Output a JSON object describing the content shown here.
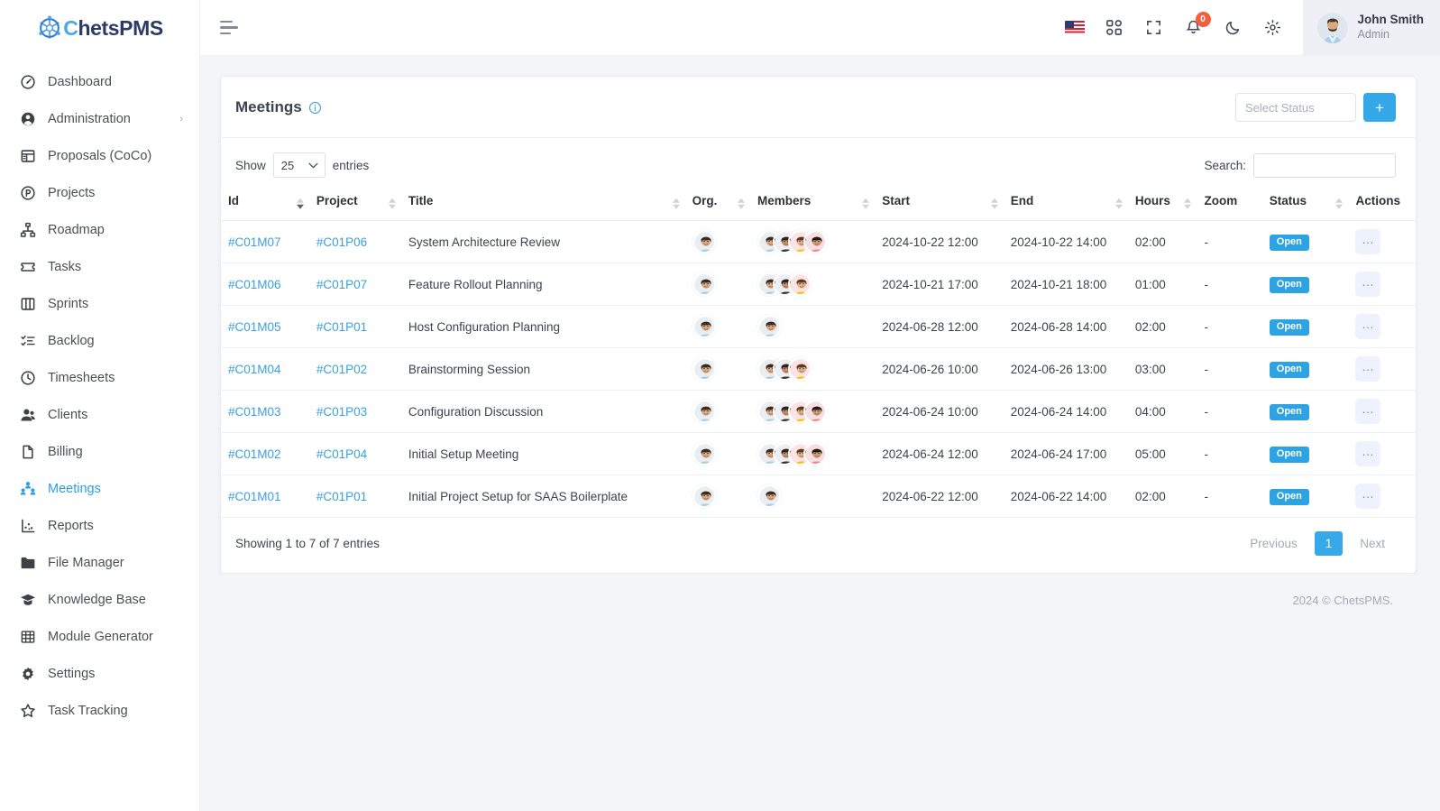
{
  "brand": {
    "name_left": "C",
    "name_full": "ChetsPMS",
    "logo_icon": "chets-logo-icon"
  },
  "sidebar": {
    "items": [
      {
        "label": "Dashboard",
        "icon": "speedometer-icon",
        "active": false,
        "caret": ""
      },
      {
        "label": "Administration",
        "icon": "user-circle-icon",
        "active": false,
        "caret": "›"
      },
      {
        "label": "Proposals (CoCo)",
        "icon": "document-layout-icon",
        "active": false,
        "caret": ""
      },
      {
        "label": "Projects",
        "icon": "circle-p-icon",
        "active": false,
        "caret": ""
      },
      {
        "label": "Roadmap",
        "icon": "hierarchy-icon",
        "active": false,
        "caret": ""
      },
      {
        "label": "Tasks",
        "icon": "ticket-icon",
        "active": false,
        "caret": ""
      },
      {
        "label": "Sprints",
        "icon": "columns-icon",
        "active": false,
        "caret": ""
      },
      {
        "label": "Backlog",
        "icon": "checklist-icon",
        "active": false,
        "caret": ""
      },
      {
        "label": "Timesheets",
        "icon": "clock-icon",
        "active": false,
        "caret": ""
      },
      {
        "label": "Clients",
        "icon": "users-icon",
        "active": false,
        "caret": ""
      },
      {
        "label": "Billing",
        "icon": "file-icon",
        "active": false,
        "caret": ""
      },
      {
        "label": "Meetings",
        "icon": "people-group-icon",
        "active": true,
        "caret": ""
      },
      {
        "label": "Reports",
        "icon": "chart-scatter-icon",
        "active": false,
        "caret": ""
      },
      {
        "label": "File Manager",
        "icon": "folder-icon",
        "active": false,
        "caret": ""
      },
      {
        "label": "Knowledge Base",
        "icon": "graduation-cap-icon",
        "active": false,
        "caret": ""
      },
      {
        "label": "Module Generator",
        "icon": "grid-table-icon",
        "active": false,
        "caret": ""
      },
      {
        "label": "Settings",
        "icon": "gear-icon",
        "active": false,
        "caret": ""
      },
      {
        "label": "Task Tracking",
        "icon": "star-icon",
        "active": false,
        "caret": ""
      }
    ]
  },
  "topbar": {
    "menu_toggle": "hamburger-icon",
    "icons": [
      {
        "name": "language-flag-us-icon"
      },
      {
        "name": "apps-grid-icon"
      },
      {
        "name": "fullscreen-icon"
      },
      {
        "name": "notifications-bell-icon",
        "badge": "0"
      },
      {
        "name": "dark-mode-moon-icon"
      },
      {
        "name": "settings-gear-icon"
      }
    ],
    "notification_count": "0",
    "user": {
      "name": "John Smith",
      "role": "Admin"
    }
  },
  "card": {
    "title": "Meetings",
    "info_icon": "info-circle-icon",
    "status_filter_placeholder": "Select Status",
    "add_label": "+"
  },
  "table_tools": {
    "show_label": "Show",
    "entries_label": "entries",
    "page_length": "25",
    "search_label": "Search:",
    "search_value": "",
    "search_placeholder": ""
  },
  "table": {
    "columns": [
      {
        "label": "Id",
        "sorted": true,
        "sortable": true
      },
      {
        "label": "Project",
        "sorted": false,
        "sortable": true
      },
      {
        "label": "Title",
        "sorted": false,
        "sortable": true
      },
      {
        "label": "Org.",
        "sorted": false,
        "sortable": true
      },
      {
        "label": "Members",
        "sorted": false,
        "sortable": true
      },
      {
        "label": "Start",
        "sorted": false,
        "sortable": true
      },
      {
        "label": "End",
        "sorted": false,
        "sortable": true
      },
      {
        "label": "Hours",
        "sorted": false,
        "sortable": true
      },
      {
        "label": "Zoom",
        "sorted": false,
        "sortable": false
      },
      {
        "label": "Status",
        "sorted": false,
        "sortable": true
      },
      {
        "label": "Actions",
        "sorted": false,
        "sortable": false
      }
    ],
    "rows": [
      {
        "id": "#C01M07",
        "project": "#C01P06",
        "title": "System Architecture Review",
        "org_count": 1,
        "member_count": 4,
        "start": "2024-10-22 12:00",
        "end": "2024-10-22 14:00",
        "hours": "02:00",
        "zoom": "-",
        "status": "Open",
        "action": "…"
      },
      {
        "id": "#C01M06",
        "project": "#C01P07",
        "title": "Feature Rollout Planning",
        "org_count": 1,
        "member_count": 3,
        "start": "2024-10-21 17:00",
        "end": "2024-10-21 18:00",
        "hours": "01:00",
        "zoom": "-",
        "status": "Open",
        "action": "…"
      },
      {
        "id": "#C01M05",
        "project": "#C01P01",
        "title": "Host Configuration Planning",
        "org_count": 1,
        "member_count": 1,
        "start": "2024-06-28 12:00",
        "end": "2024-06-28 14:00",
        "hours": "02:00",
        "zoom": "-",
        "status": "Open",
        "action": "…"
      },
      {
        "id": "#C01M04",
        "project": "#C01P02",
        "title": "Brainstorming Session",
        "org_count": 1,
        "member_count": 3,
        "start": "2024-06-26 10:00",
        "end": "2024-06-26 13:00",
        "hours": "03:00",
        "zoom": "-",
        "status": "Open",
        "action": "…"
      },
      {
        "id": "#C01M03",
        "project": "#C01P03",
        "title": "Configuration Discussion",
        "org_count": 1,
        "member_count": 4,
        "start": "2024-06-24 10:00",
        "end": "2024-06-24 14:00",
        "hours": "04:00",
        "zoom": "-",
        "status": "Open",
        "action": "…"
      },
      {
        "id": "#C01M02",
        "project": "#C01P04",
        "title": "Initial Setup Meeting",
        "org_count": 1,
        "member_count": 4,
        "start": "2024-06-24 12:00",
        "end": "2024-06-24 17:00",
        "hours": "05:00",
        "zoom": "-",
        "status": "Open",
        "action": "…"
      },
      {
        "id": "#C01M01",
        "project": "#C01P01",
        "title": "Initial Project Setup for SAAS Boilerplate",
        "org_count": 1,
        "member_count": 1,
        "start": "2024-06-22 12:00",
        "end": "2024-06-22 14:00",
        "hours": "02:00",
        "zoom": "-",
        "status": "Open",
        "action": "…"
      }
    ]
  },
  "footer": {
    "info": "Showing 1 to 7 of 7 entries",
    "previous": "Previous",
    "page": "1",
    "next": "Next",
    "copyright": "2024 © ChetsPMS."
  },
  "colors": {
    "accent": "#34a8e8",
    "badge_open": "#2ea3e4",
    "link": "#3a9fe0",
    "notification": "#f2603c",
    "content_bg": "#f4f5f9"
  }
}
